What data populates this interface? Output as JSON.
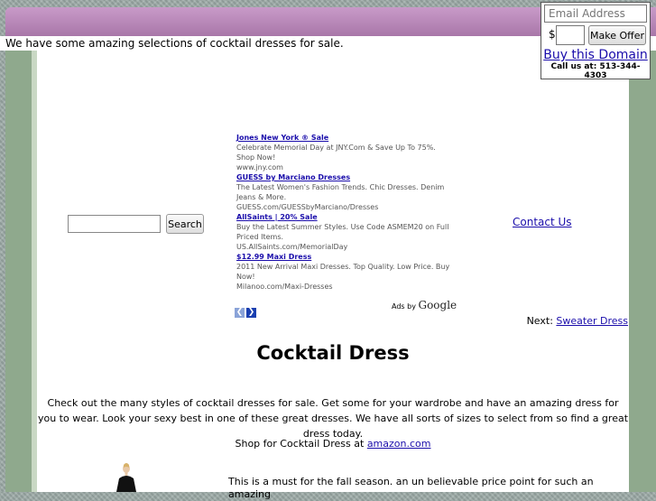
{
  "tagline": "We have some amazing selections of cocktail dresses for sale.",
  "offer": {
    "email_placeholder": "Email Address",
    "currency": "$",
    "button": "Make Offer",
    "buy_link": "Buy this Domain",
    "call": "Call us at: 513-344-4303"
  },
  "search": {
    "button": "Search"
  },
  "ads": [
    {
      "title": "Jones New York ® Sale",
      "text": "Celebrate Memorial Day at JNY.Com & Save Up To 75%. Shop Now!",
      "url": "www.jny.com"
    },
    {
      "title": "GUESS by Marciano Dresses",
      "text": "The Latest Women's Fashion Trends. Chic Dresses. Denim Jeans & More.",
      "url": "GUESS.com/GUESSbyMarciano/Dresses"
    },
    {
      "title": "AllSaints | 20% Sale",
      "text": "Buy the Latest Summer Styles. Use Code ASMEM20 on Full Priced Items.",
      "url": "US.AllSaints.com/MemorialDay"
    },
    {
      "title": "$12.99 Maxi Dress",
      "text": "2011 New Arrival Maxi Dresses. Top Quality. Low Price. Buy Now!",
      "url": "Milanoo.com/Maxi-Dresses"
    }
  ],
  "ads_by": "Ads by",
  "ads_brand": "Google",
  "contact": "Contact Us",
  "next": {
    "label": "Next:",
    "link": "Sweater Dress"
  },
  "title": "Cocktail Dress",
  "intro": "Check out the many styles of cocktail dresses for sale. Get some for your wardrobe and have an amazing dress for you to wear. Look your sexy best in one of these great dresses. We have all sorts of sizes to select from so find a great dress today.",
  "shop": {
    "text": "Shop for Cocktail Dress at",
    "link": "amazon.com"
  },
  "description": "This is a must for the fall season. an un believable price point for such an amazing"
}
